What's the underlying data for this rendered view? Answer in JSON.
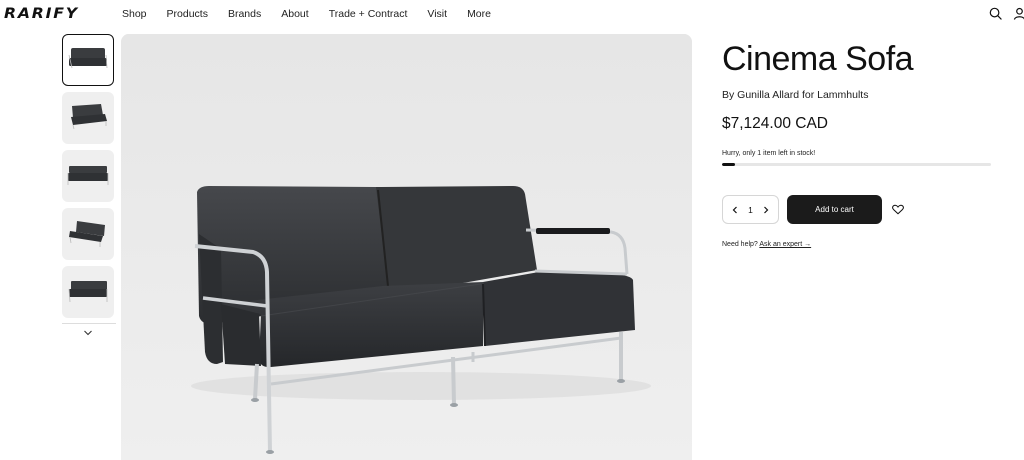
{
  "header": {
    "logo": "RARIFY",
    "nav": [
      "Shop",
      "Products",
      "Brands",
      "About",
      "Trade + Contract",
      "Visit",
      "More"
    ],
    "icons": [
      "search-icon",
      "account-icon"
    ]
  },
  "gallery": {
    "thumbnail_count": 5,
    "active_index": 0,
    "next_icon": "chevron-down-icon"
  },
  "product": {
    "title": "Cinema Sofa",
    "byline": "By Gunilla Allard for Lammhults",
    "price": "$7,124.00 CAD",
    "stock_message": "Hurry, only 1 item left in stock!",
    "stock_level": 0.05,
    "quantity": "1",
    "add_to_cart_label": "Add to cart",
    "help_prefix": "Need help?",
    "help_link": "Ask an expert →"
  },
  "colors": {
    "button_bg": "#1b1b1b",
    "image_bg": "#e9e9e9",
    "sofa_leather": "#3a3c3f",
    "chrome": "#c8cbce"
  }
}
